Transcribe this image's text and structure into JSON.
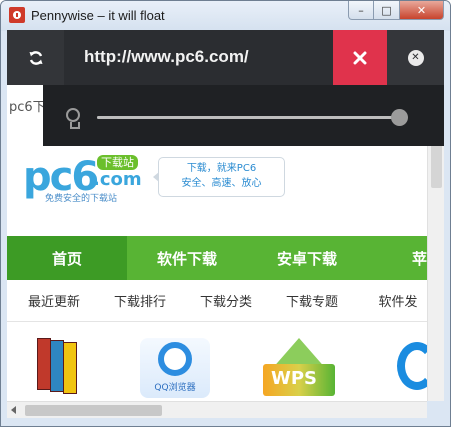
{
  "window": {
    "title": "Pennywise – it will float",
    "caption": {
      "minimize": "–",
      "maximize": "□",
      "close": "✕"
    }
  },
  "toolbar": {
    "url": "http://www.pc6.com/",
    "reload_icon": "reload-icon",
    "clear_icon": "close-x-icon",
    "hide_icon": "close-circle-icon",
    "bulb_icon": "lightbulb-icon",
    "opacity_fraction": 0.98,
    "accent": "#e0334c"
  },
  "page": {
    "address_peek": "pc6下",
    "logo": {
      "pc6": "pc6",
      "com": ".com",
      "badge": "下载站",
      "tagline": "免费安全的下载站"
    },
    "slogan": {
      "line1": "下载，就来PC6",
      "line2": "安全、高速、放心"
    },
    "nav": [
      {
        "label": "首页"
      },
      {
        "label": "软件下载"
      },
      {
        "label": "安卓下载"
      },
      {
        "label": "苹果"
      }
    ],
    "subnav": [
      {
        "label": "最近更新"
      },
      {
        "label": "下载排行"
      },
      {
        "label": "下载分类"
      },
      {
        "label": "下载专题"
      },
      {
        "label": "软件发"
      }
    ],
    "apps": {
      "qq_label": "QQ浏览器",
      "wps_text": "WPS"
    },
    "watermark": "pc6"
  }
}
